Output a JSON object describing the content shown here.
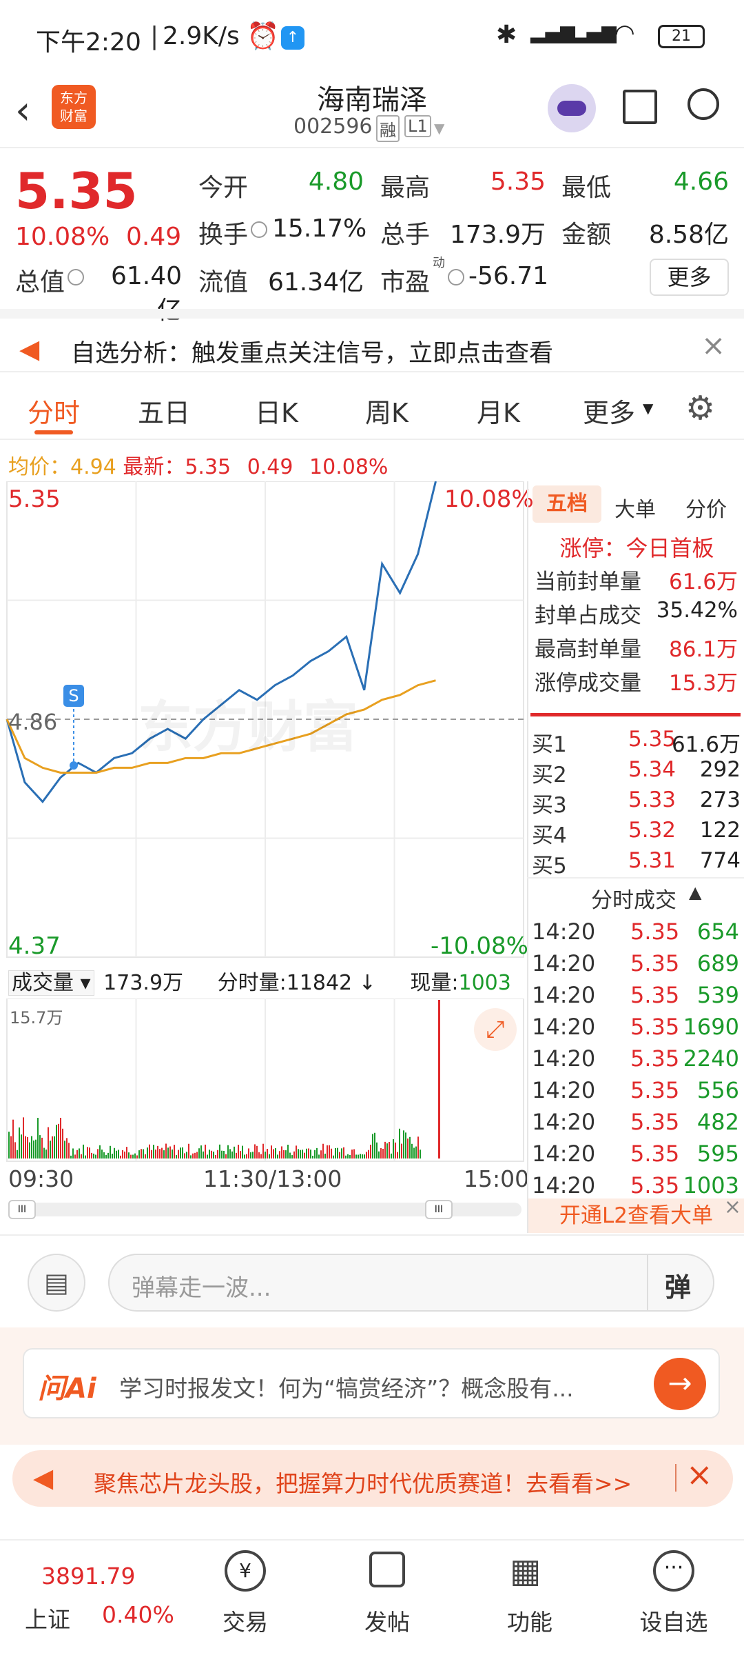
{
  "statusbar": {
    "time": "下午2:20",
    "speed": "2.9K/s",
    "battery": "21"
  },
  "nav": {
    "stock_name": "海南瑞泽",
    "stock_code": "002596",
    "tag1": "融",
    "tag2": "L1",
    "logo_text1": "东方",
    "logo_text2": "财富"
  },
  "quote": {
    "price": "5.35",
    "change_pct": "10.08%",
    "change": "0.49",
    "open_label": "今开",
    "open": "4.80",
    "high_label": "最高",
    "high": "5.35",
    "low_label": "最低",
    "low": "4.66",
    "turnover_label": "换手",
    "turnover": "15.17%",
    "volume_label": "总手",
    "volume": "173.9万",
    "amount_label": "金额",
    "amount": "8.58亿",
    "mktcap_label": "总值",
    "mktcap": "61.40亿",
    "float_label": "流值",
    "float": "61.34亿",
    "pe_label": "市盈",
    "pe_sup": "动",
    "pe": "-56.71",
    "more_button": "更多"
  },
  "banner": {
    "text": "自选分析：触发重点关注信号，立即点击查看"
  },
  "tabs": [
    "分时",
    "五日",
    "日K",
    "周K",
    "月K",
    "更多"
  ],
  "chart_header": {
    "avg_label": "均价：",
    "avg": "4.94",
    "latest_label": "最新：",
    "latest": "5.35",
    "chg": "0.49",
    "chg_pct": "10.08%"
  },
  "chart_labels": {
    "top_price": "5.35",
    "top_pct": "10.08%",
    "mid_price": "4.86",
    "bot_price": "4.37",
    "bot_pct": "-10.08%",
    "watermark": "东方财富",
    "marker": "S"
  },
  "volume_header": {
    "label": "成交量",
    "total": "173.9万",
    "interval": "分时量:11842",
    "current_label": "现量:",
    "current": "1003",
    "max_label": "15.7万"
  },
  "time_axis": [
    "09:30",
    "11:30/13:00",
    "15:00"
  ],
  "chart_data": {
    "type": "line",
    "title": "",
    "xlabel": "",
    "ylabel": "",
    "ylim": [
      4.37,
      5.35
    ],
    "x": [
      "09:30",
      "09:35",
      "09:40",
      "09:45",
      "09:50",
      "10:00",
      "10:10",
      "10:20",
      "10:30",
      "10:40",
      "10:50",
      "11:00",
      "11:10",
      "11:20",
      "11:30",
      "13:10",
      "13:20",
      "13:30",
      "13:40",
      "13:50",
      "14:00",
      "14:05",
      "14:10",
      "14:15",
      "14:20"
    ],
    "series": [
      {
        "values": [
          4.86,
          4.73,
          4.69,
          4.74,
          4.77,
          4.75,
          4.78,
          4.79,
          4.82,
          4.84,
          4.82,
          4.86,
          4.89,
          4.92,
          4.9,
          4.93,
          4.95,
          4.98,
          5.0,
          5.03,
          4.92,
          5.18,
          5.12,
          5.2,
          5.35
        ]
      },
      {
        "values": [
          4.86,
          4.78,
          4.76,
          4.75,
          4.75,
          4.75,
          4.76,
          4.76,
          4.77,
          4.77,
          4.78,
          4.78,
          4.79,
          4.79,
          4.8,
          4.81,
          4.82,
          4.83,
          4.85,
          4.87,
          4.88,
          4.9,
          4.91,
          4.93,
          4.94
        ]
      }
    ],
    "ref_line": 4.86
  },
  "right_panel": {
    "tabs": [
      "五档",
      "大单",
      "分价"
    ],
    "limit_title": "涨停：今日首板",
    "limit_rows": [
      {
        "label": "当前封单量",
        "value": "61.6万"
      },
      {
        "label": "封单占成交",
        "value": "35.42%"
      },
      {
        "label": "最高封单量",
        "value": "86.1万"
      },
      {
        "label": "涨停成交量",
        "value": "15.3万"
      }
    ],
    "bids": [
      {
        "label": "买1",
        "price": "5.35",
        "vol": "61.6万"
      },
      {
        "label": "买2",
        "price": "5.34",
        "vol": "292"
      },
      {
        "label": "买3",
        "price": "5.33",
        "vol": "273"
      },
      {
        "label": "买4",
        "price": "5.32",
        "vol": "122"
      },
      {
        "label": "买5",
        "price": "5.31",
        "vol": "774"
      }
    ],
    "trades_title": "分时成交",
    "trades": [
      {
        "time": "14:20",
        "price": "5.35",
        "vol": "654"
      },
      {
        "time": "14:20",
        "price": "5.35",
        "vol": "689"
      },
      {
        "time": "14:20",
        "price": "5.35",
        "vol": "539"
      },
      {
        "time": "14:20",
        "price": "5.35",
        "vol": "1690"
      },
      {
        "time": "14:20",
        "price": "5.35",
        "vol": "2240"
      },
      {
        "time": "14:20",
        "price": "5.35",
        "vol": "556"
      },
      {
        "time": "14:20",
        "price": "5.35",
        "vol": "482"
      },
      {
        "time": "14:20",
        "price": "5.35",
        "vol": "595"
      },
      {
        "time": "14:20",
        "price": "5.35",
        "vol": "1003"
      }
    ],
    "l2_link": "开通L2查看大单"
  },
  "comment": {
    "placeholder": "弹幕走一波...",
    "danmu_btn": "弹"
  },
  "ai": {
    "logo": "问Ai",
    "text": "学习时报发文！何为“犒赏经济”？概念股有..."
  },
  "promo": {
    "text": "聚焦芯片龙头股，把握算力时代优质赛道！去看看>>"
  },
  "bottom_nav": {
    "index_value": "3891.79",
    "index_name": "上证",
    "index_pct": "0.40%",
    "items": [
      "交易",
      "发帖",
      "功能",
      "设自选"
    ]
  }
}
